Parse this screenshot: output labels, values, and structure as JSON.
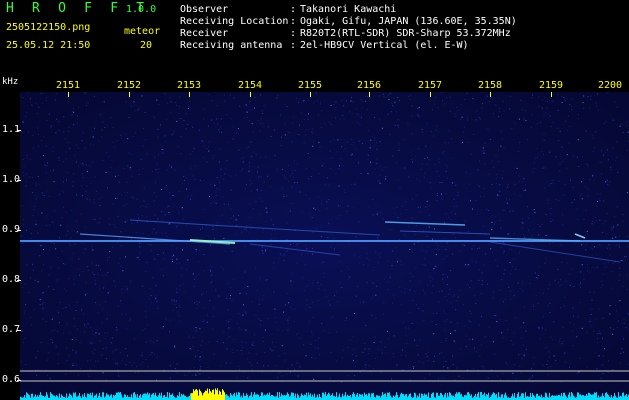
{
  "header": {
    "app_title": "H R O F F T",
    "app_version": "1.0.0",
    "file_name": "2505122150.png",
    "mode_label": "meteor",
    "date_time": "25.05.12 21:50",
    "count_value": "20"
  },
  "station_info": [
    {
      "label": "Observer",
      "value": "Takanori Kawachi"
    },
    {
      "label": "Receiving Location",
      "value": "Ogaki, Gifu, JAPAN (136.60E, 35.35N)"
    },
    {
      "label": "Receiver",
      "value": "R820T2(RTL-SDR) SDR-Sharp 53.372MHz"
    },
    {
      "label": "Receiving antenna",
      "value": "2el-HB9CV Vertical (el. E-W)"
    }
  ],
  "colon": ":",
  "y_axis": {
    "unit": "kHz",
    "ticks": [
      "1.1",
      "1.0",
      "0.9",
      "0.8",
      "0.7",
      "0.6"
    ],
    "tick_values": [
      1.1,
      1.0,
      0.9,
      0.8,
      0.7,
      0.6
    ]
  },
  "x_axis": {
    "ticks": [
      "2151",
      "2152",
      "2153",
      "2154",
      "2155",
      "2156",
      "2157",
      "2158",
      "2159",
      "2200"
    ]
  },
  "colors": {
    "background": "#000000",
    "spectrogram_bg": "#060a3c",
    "signal": "#3c8cff",
    "meteor_bright": "#a0ffb4",
    "reference_line": "#c8c8c8",
    "noise_floor": "#00dcff",
    "noise_burst": "#ffff00",
    "label_yellow": "#ffff00",
    "label_green": "#33ff33",
    "label_white": "#ffffff"
  }
}
